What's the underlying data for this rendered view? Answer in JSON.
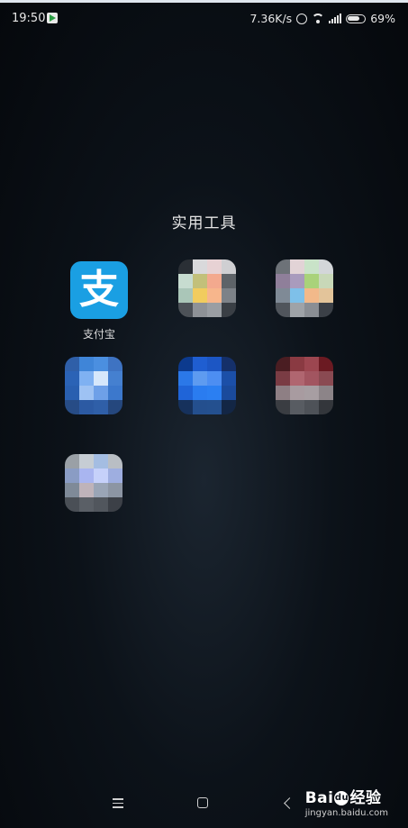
{
  "status_bar": {
    "time": "19:50",
    "net_speed": "7.36K/s",
    "battery": "69%"
  },
  "folder": {
    "title": "实用工具",
    "apps": [
      {
        "label": "支付宝",
        "icon": "alipay-icon",
        "brand_color": "#1a9fe3",
        "glyph": "支"
      },
      {
        "label": "",
        "icon": "blurred-app-icon"
      },
      {
        "label": "",
        "icon": "blurred-app-icon"
      },
      {
        "label": "",
        "icon": "blurred-app-icon"
      },
      {
        "label": "",
        "icon": "blurred-app-icon"
      },
      {
        "label": "",
        "icon": "blurred-app-icon"
      },
      {
        "label": "",
        "icon": "blurred-app-icon"
      }
    ]
  },
  "nav_bar": {
    "menu": "menu-icon",
    "home": "home-icon",
    "back": "back-icon"
  },
  "watermark": {
    "brand_left": "Bai",
    "brand_mid": "du",
    "brand_right": "经验",
    "site": "jingyan.baidu.com"
  }
}
